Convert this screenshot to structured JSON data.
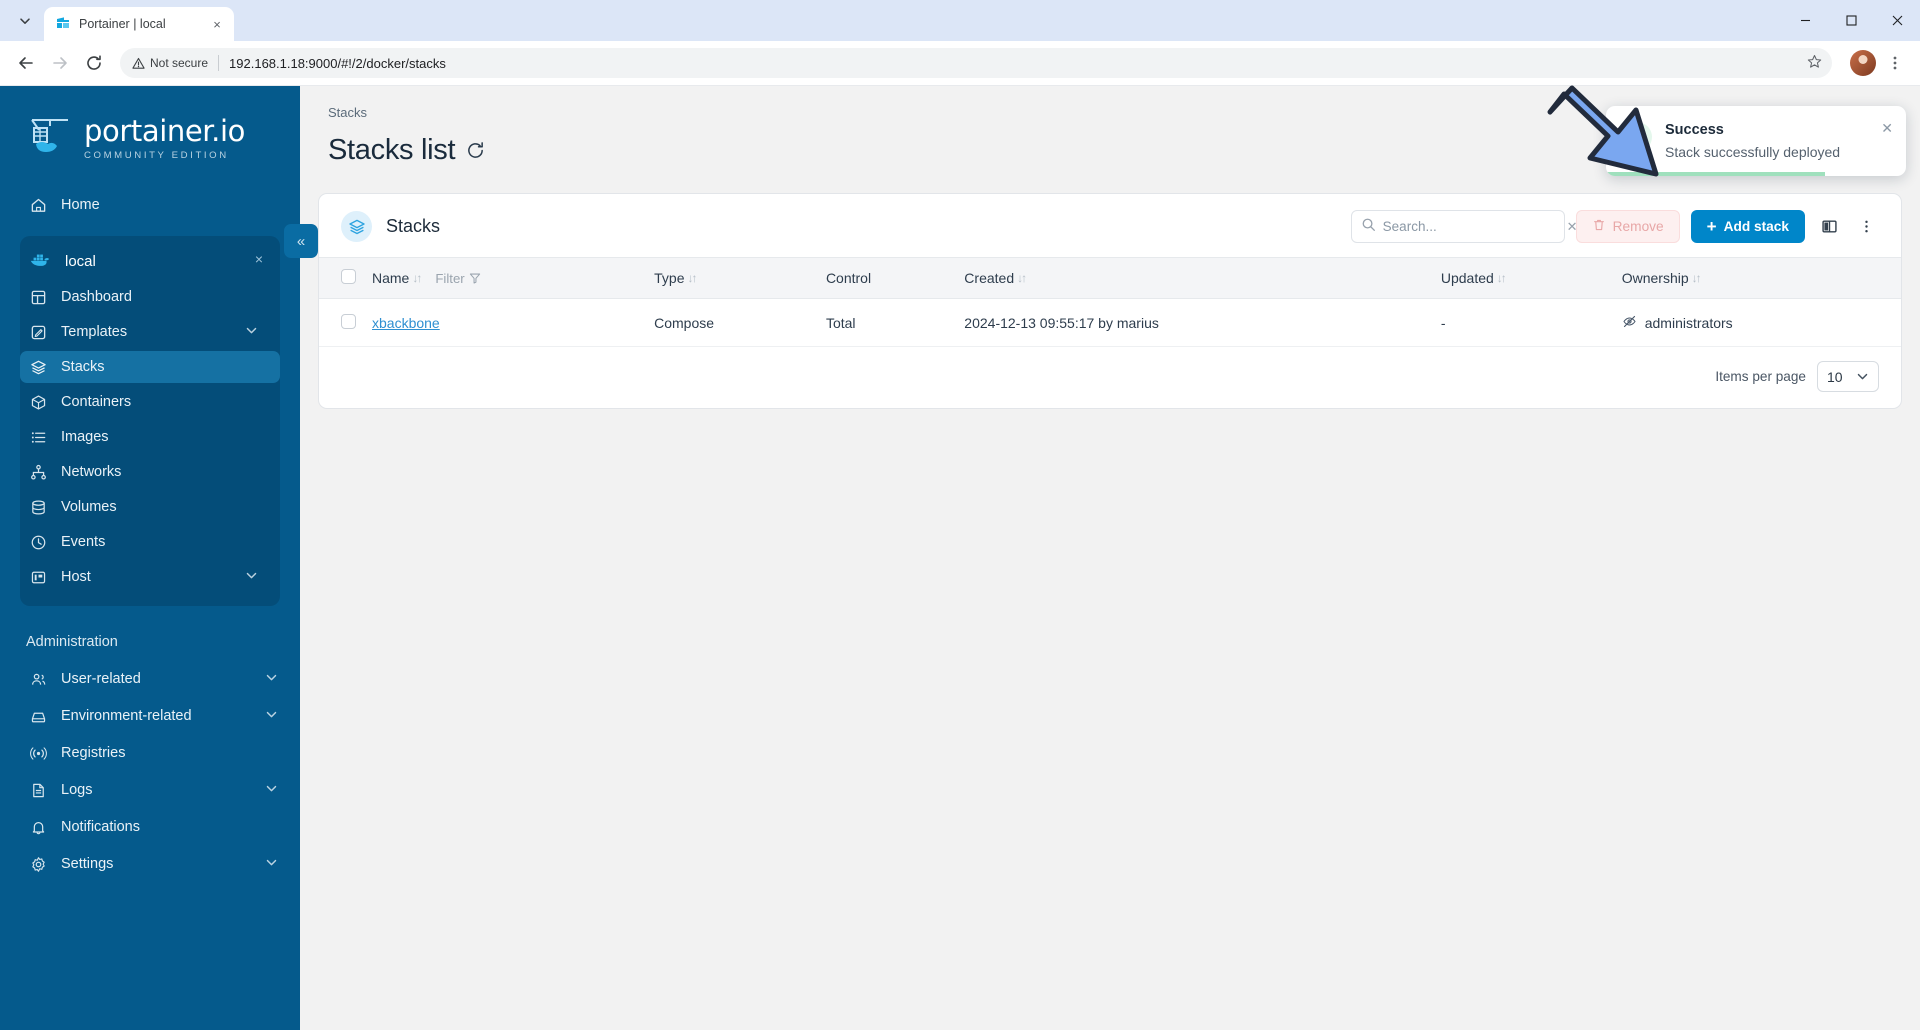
{
  "browser": {
    "tab": {
      "title": "Portainer | local",
      "favicon_name": "portainer-favicon",
      "close_label": "×"
    },
    "tab_list_chevron": "⌄",
    "nav": {
      "back": "←",
      "forward": "→",
      "reload": "⟳"
    },
    "omnibox": {
      "security_label": "Not secure",
      "url": "192.168.1.18:9000/#!/2/docker/stacks",
      "star": "☆"
    },
    "window": {
      "minimize": "—",
      "maximize": "□",
      "close": "✕"
    },
    "menu": "⋮"
  },
  "sidebar": {
    "logo": {
      "title": "portainer.io",
      "subtitle": "COMMUNITY EDITION"
    },
    "collapse_label": "«",
    "home": {
      "label": "Home",
      "icon": "home-icon"
    },
    "environment": {
      "name": "local",
      "icon": "docker-icon",
      "close_label": "×",
      "items": [
        {
          "label": "Dashboard",
          "icon": "dashboard-icon",
          "active": false,
          "chevron": ""
        },
        {
          "label": "Templates",
          "icon": "templates-icon",
          "active": false,
          "chevron": "⌄"
        },
        {
          "label": "Stacks",
          "icon": "stacks-icon",
          "active": true,
          "chevron": ""
        },
        {
          "label": "Containers",
          "icon": "containers-icon",
          "active": false,
          "chevron": ""
        },
        {
          "label": "Images",
          "icon": "images-icon",
          "active": false,
          "chevron": ""
        },
        {
          "label": "Networks",
          "icon": "networks-icon",
          "active": false,
          "chevron": ""
        },
        {
          "label": "Volumes",
          "icon": "volumes-icon",
          "active": false,
          "chevron": ""
        },
        {
          "label": "Events",
          "icon": "events-icon",
          "active": false,
          "chevron": ""
        },
        {
          "label": "Host",
          "icon": "host-icon",
          "active": false,
          "chevron": "⌄"
        }
      ]
    },
    "admin_heading": "Administration",
    "admin_items": [
      {
        "label": "User-related",
        "icon": "users-icon",
        "chevron": "⌄"
      },
      {
        "label": "Environment-related",
        "icon": "environment-icon",
        "chevron": "⌄"
      },
      {
        "label": "Registries",
        "icon": "registries-icon",
        "chevron": ""
      },
      {
        "label": "Logs",
        "icon": "logs-icon",
        "chevron": "⌄"
      },
      {
        "label": "Notifications",
        "icon": "bell-icon",
        "chevron": ""
      },
      {
        "label": "Settings",
        "icon": "gear-icon",
        "chevron": "⌄"
      }
    ]
  },
  "main": {
    "breadcrumb": "Stacks",
    "page_title": "Stacks list",
    "refresh_icon": "refresh-icon",
    "card": {
      "title": "Stacks",
      "icon": "stacks-icon",
      "search": {
        "placeholder": "Search...",
        "value": "",
        "clear": "✕"
      },
      "remove_label": "Remove",
      "add_label": "Add stack",
      "add_plus": "+",
      "columns_icon": "columns-icon",
      "more_icon": "more-vertical-icon"
    },
    "table": {
      "columns": [
        {
          "label": "Name",
          "sortable": true,
          "filter": "Filter"
        },
        {
          "label": "Type",
          "sortable": true
        },
        {
          "label": "Control",
          "sortable": false
        },
        {
          "label": "Created",
          "sortable": true
        },
        {
          "label": "Updated",
          "sortable": true
        },
        {
          "label": "Ownership",
          "sortable": true
        }
      ],
      "rows": [
        {
          "name": "xbackbone",
          "type": "Compose",
          "control": "Total",
          "created": "2024-12-13 09:55:17 by marius",
          "updated": "-",
          "ownership": "administrators",
          "ownership_icon": "eye-off-icon"
        }
      ]
    },
    "footer": {
      "items_per_page_label": "Items per page",
      "items_per_page_value": "10",
      "chevron": "⌄"
    }
  },
  "toast": {
    "title": "Success",
    "message": "Stack successfully deployed",
    "close": "✕",
    "icon": "check-circle-icon",
    "accent_color": "#2e9e63"
  },
  "annotation": {
    "arrow": "pointer-arrow",
    "color": "#7aa7f0"
  },
  "colors": {
    "sidebar_bg": "#055a8c",
    "sidebar_active": "#1571a3",
    "primary": "#0086c9",
    "link": "#2e8fd1",
    "success": "#2e9e63"
  }
}
